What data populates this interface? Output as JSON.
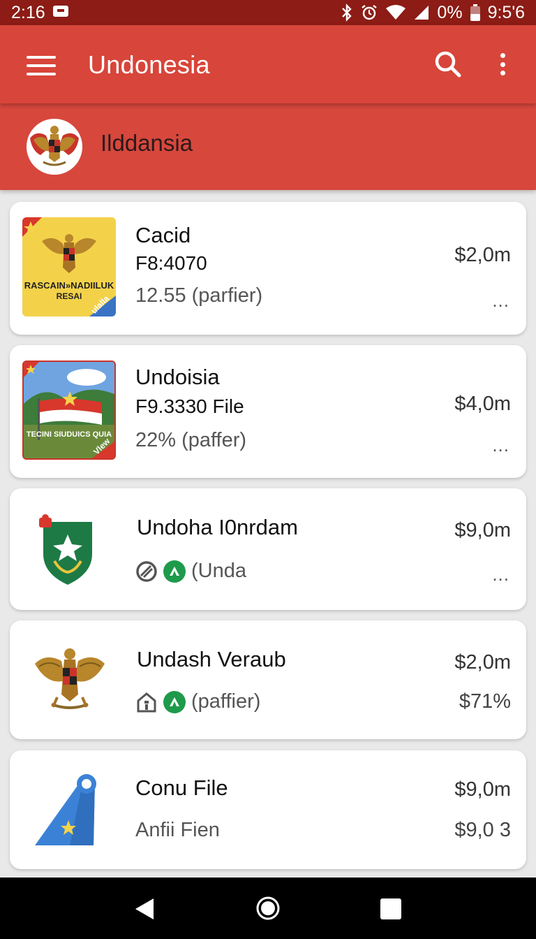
{
  "status_bar": {
    "time": "2:16",
    "battery": "0%",
    "clock_right": "9:5'6",
    "icons": [
      "notification-icon",
      "bluetooth-icon",
      "alarm-icon",
      "wifi-icon",
      "signal-icon",
      "battery-icon"
    ]
  },
  "app_bar": {
    "title": "Undonesia",
    "icons": [
      "menu-icon",
      "search-icon",
      "more-vert-icon"
    ],
    "color": "#d8453a"
  },
  "sub_header": {
    "title": "Ilddansia",
    "color": "#d7473c"
  },
  "items": [
    {
      "name": "Cacid",
      "subtitle": "F8:4070",
      "meta": "12.55 (parfier)",
      "price": "$2,0m",
      "more": "...",
      "thumb_text_1": "RASCAIN»NADIILUK",
      "thumb_text_2": "RESAI",
      "thumb_ribbon": "ulalla"
    },
    {
      "name": "Undoisia",
      "subtitle": "F9.3330 File",
      "meta": "22% (paffer)",
      "price": "$4,0m",
      "more": "...",
      "thumb_text_1": "TECINI SIUDUICS QUIA",
      "thumb_ribbon": "Vlew"
    },
    {
      "name": "Undoha I0nrdam",
      "meta": "(Unda",
      "price": "$9,0m",
      "more": "..."
    },
    {
      "name": "Undash Veraub",
      "meta": "(paffier)",
      "price": "$2,0m",
      "extra": "$71%"
    },
    {
      "name": "Conu File",
      "meta": "Anfii Fien",
      "price": "$9,0m",
      "extra": "$9,0 3"
    }
  ],
  "nav_bar": {
    "icons": [
      "back-icon",
      "home-icon",
      "recent-apps-icon"
    ]
  }
}
